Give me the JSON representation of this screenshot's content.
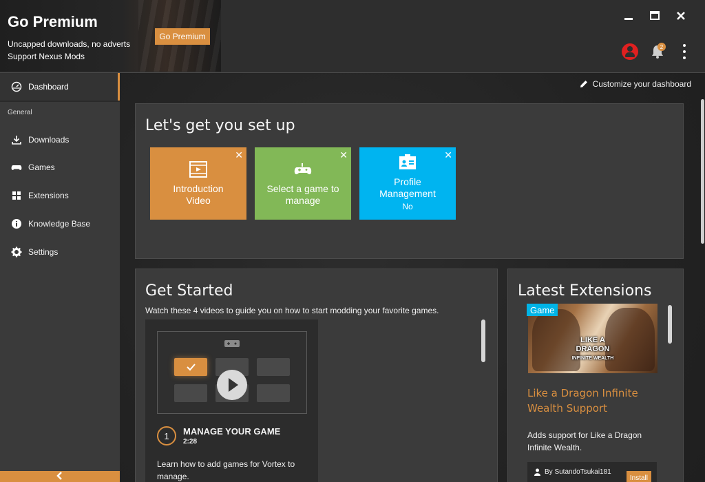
{
  "premium": {
    "title": "Go Premium",
    "line1": "Uncapped downloads, no adverts",
    "line2": "Support Nexus Mods",
    "button_label": "Go Premium"
  },
  "window": {
    "minimize_icon": "minimize-icon",
    "maximize_icon": "maximize-icon",
    "close_icon": "close-icon"
  },
  "header": {
    "notification_count": "2"
  },
  "sidebar": {
    "dashboard_label": "Dashboard",
    "section_label": "General",
    "items": [
      {
        "label": "Downloads",
        "icon": "download-icon"
      },
      {
        "label": "Games",
        "icon": "gamepad-icon"
      },
      {
        "label": "Extensions",
        "icon": "extensions-icon"
      },
      {
        "label": "Knowledge Base",
        "icon": "info-icon"
      },
      {
        "label": "Settings",
        "icon": "gear-icon"
      }
    ]
  },
  "dashboard": {
    "customize_label": "Customize your dashboard",
    "setup": {
      "title": "Let's get you set up",
      "tiles": [
        {
          "label": "Introduction Video",
          "color": "#d98f40",
          "icon": "video-icon"
        },
        {
          "label": "Select a game to manage",
          "color": "#82b857",
          "icon": "gamepad-icon"
        },
        {
          "label": "Profile Management",
          "sub": "No",
          "color": "#00b4f0",
          "icon": "profile-card-icon"
        }
      ]
    },
    "get_started": {
      "title": "Get Started",
      "description": "Watch these 4 videos to guide you on how to start modding your favorite games.",
      "video": {
        "number": "1",
        "title": "MANAGE YOUR GAME",
        "duration": "2:28",
        "description": "Learn how to add games for Vortex to manage."
      }
    },
    "latest_extensions": {
      "title": "Latest Extensions",
      "badge": "Game",
      "image_logo_top": "LIKE A DRAGON",
      "image_logo_bottom": "INFINITE WEALTH",
      "name": "Like a Dragon Infinite Wealth Support",
      "description": "Adds support for Like a Dragon Infinite Wealth.",
      "author": "By SutandoTsukai181",
      "install_label": "Install"
    }
  },
  "colors": {
    "accent": "#d98f40",
    "notification_red": "#e02020",
    "game_badge": "#00b4e6"
  }
}
